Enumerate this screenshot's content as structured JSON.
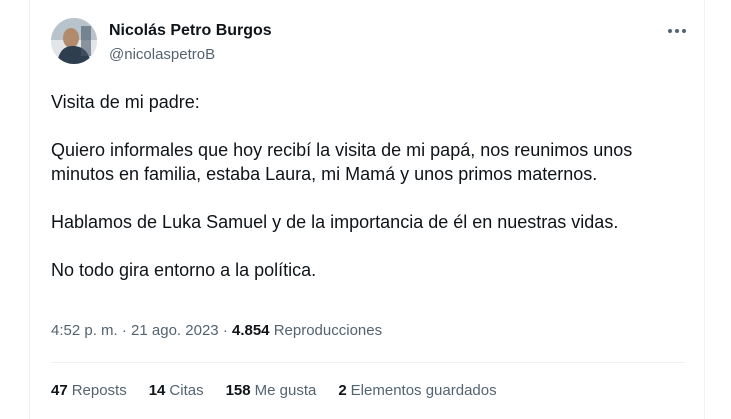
{
  "author": {
    "name": "Nicolás Petro Burgos",
    "handle": "@nicolaspetroB"
  },
  "tweet": {
    "paragraphs": [
      "Visita de mi padre:",
      "Quiero informales que hoy recibí la visita de mi papá, nos reunimos unos minutos en familia, estaba Laura, mi Mamá y unos primos maternos.",
      "Hablamos de Luka Samuel y de la importancia de él en nuestras vidas.",
      "No todo gira entorno a la política."
    ],
    "time": "4:52 p. m.",
    "separator": "·",
    "date": "21 ago. 2023",
    "views_count": "4.854",
    "views_label": "Reproducciones"
  },
  "stats": {
    "reposts_count": "47",
    "reposts_label": "Reposts",
    "quotes_count": "14",
    "quotes_label": "Citas",
    "likes_count": "158",
    "likes_label": "Me gusta",
    "bookmarks_count": "2",
    "bookmarks_label": "Elementos guardados"
  },
  "icons": {
    "more": "more-options-icon"
  },
  "colors": {
    "primary_text": "#0f1419",
    "secondary_text": "#536471",
    "divider": "#eff3f4"
  }
}
